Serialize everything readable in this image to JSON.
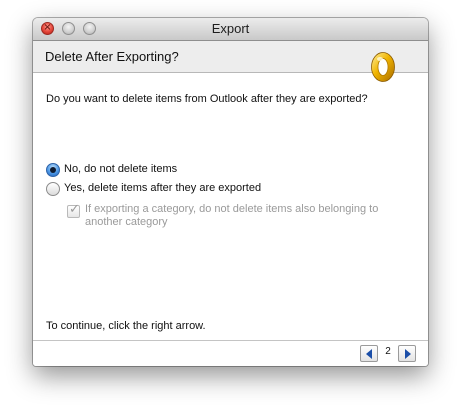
{
  "window": {
    "title": "Export"
  },
  "header": {
    "title": "Delete After Exporting?",
    "logo_icon": "outlook-logo-icon"
  },
  "main": {
    "question": "Do you want to delete items from Outlook after they are exported?",
    "options": [
      {
        "label": "No, do not delete items",
        "selected": true
      },
      {
        "label": "Yes, delete items after they are exported",
        "selected": false
      }
    ],
    "sub_option": {
      "label": "If exporting a category, do not delete items also belonging to another category",
      "checked": true,
      "enabled": false
    },
    "continue_text": "To continue, click the right arrow."
  },
  "footer": {
    "page": "2"
  },
  "colors": {
    "accent": "#1b4ea8",
    "close_button": "#e4463a",
    "logo_gold": "#e5a300"
  }
}
